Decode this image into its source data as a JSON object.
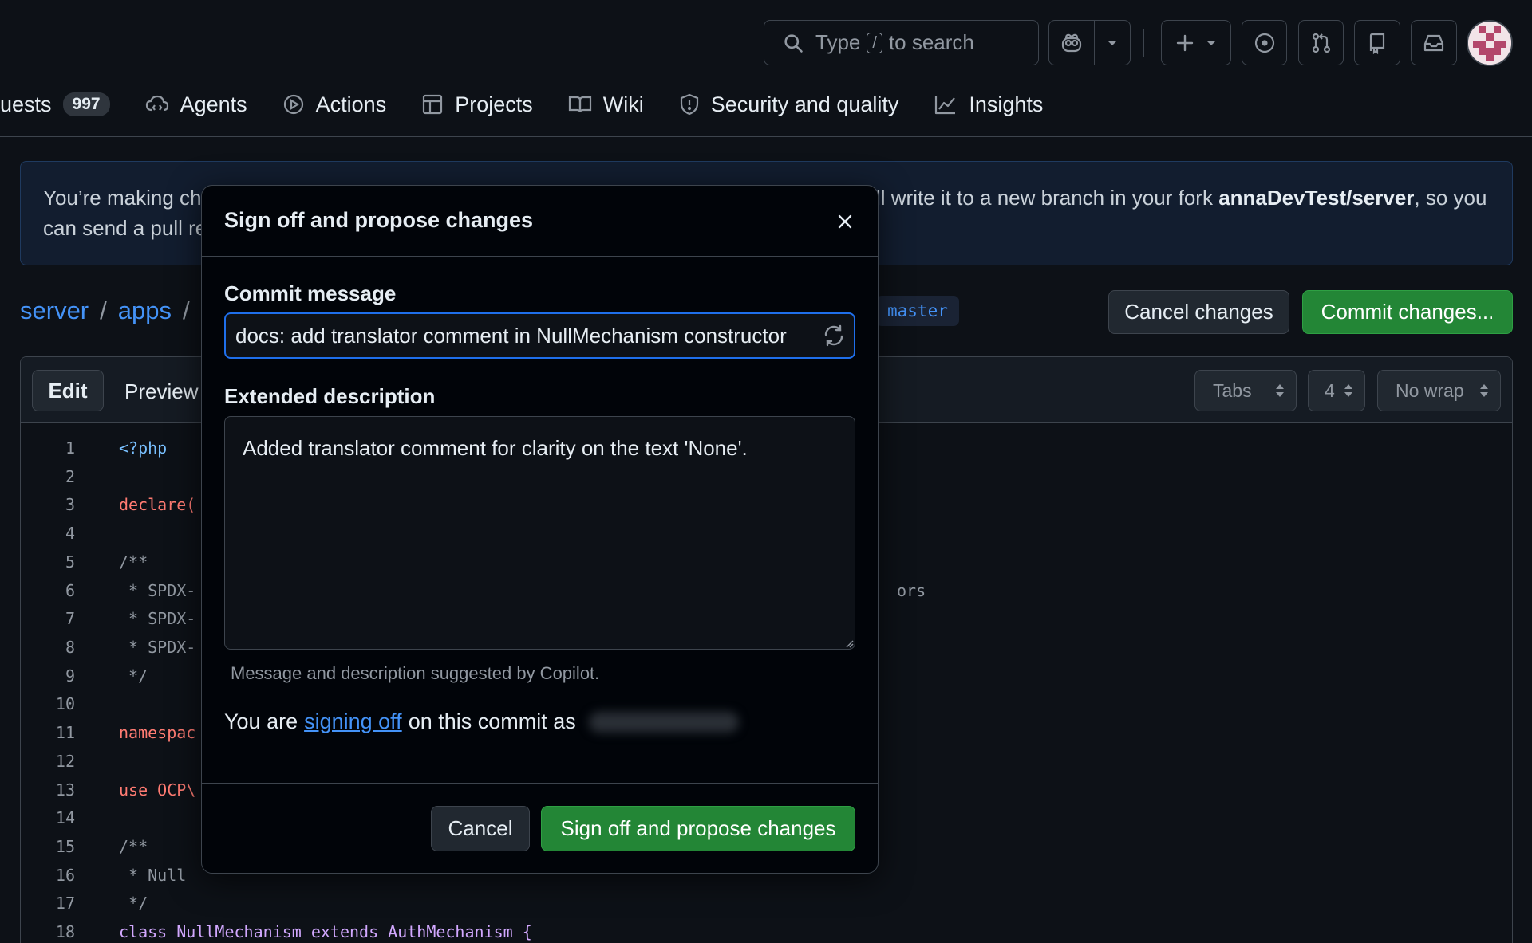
{
  "header": {
    "search_prefix": "Type",
    "search_key": "/",
    "search_suffix": "to search"
  },
  "repo_nav": {
    "items": [
      {
        "label": "uests",
        "counter": "997"
      },
      {
        "label": "Agents"
      },
      {
        "label": "Actions"
      },
      {
        "label": "Projects"
      },
      {
        "label": "Wiki"
      },
      {
        "label": "Security and quality"
      },
      {
        "label": "Insights"
      }
    ]
  },
  "banner": {
    "line1_left": "You’re making ch",
    "line1_right_pre": "ll write it to a new branch in your fork ",
    "fork_name": "annaDevTest/server",
    "line1_right_post": ", so you",
    "line2_left": "can send a pull re"
  },
  "breadcrumb": {
    "repo": "server",
    "folder": "apps",
    "sep": "/"
  },
  "branch": "master",
  "toolbar": {
    "cancel_changes": "Cancel changes",
    "commit_changes": "Commit changes..."
  },
  "editor": {
    "tab_edit": "Edit",
    "tab_preview": "Preview",
    "indent_mode": "Tabs",
    "indent_size": "4",
    "wrap_mode": "No wrap",
    "lines": [
      {
        "n": "1",
        "text": "<?php"
      },
      {
        "n": "2",
        "text": ""
      },
      {
        "n": "3",
        "text": "declare("
      },
      {
        "n": "4",
        "text": ""
      },
      {
        "n": "5",
        "text": "/**"
      },
      {
        "n": "6",
        "text": " * SPDX-"
      },
      {
        "n": "7",
        "text": " * SPDX-"
      },
      {
        "n": "8",
        "text": " * SPDX-"
      },
      {
        "n": "9",
        "text": " */"
      },
      {
        "n": "10",
        "text": ""
      },
      {
        "n": "11",
        "text": "namespac"
      },
      {
        "n": "12",
        "text": ""
      },
      {
        "n": "13",
        "text": "use OCP\\"
      },
      {
        "n": "14",
        "text": ""
      },
      {
        "n": "15",
        "text": "/**"
      },
      {
        "n": "16",
        "text": " * Null "
      },
      {
        "n": "17",
        "text": " */"
      },
      {
        "n": "18",
        "text": "class NullMechanism extends AuthMechanism {"
      }
    ],
    "line6_tail": "ors"
  },
  "modal": {
    "title": "Sign off and propose changes",
    "commit_label": "Commit message",
    "commit_value": "docs: add translator comment in NullMechanism constructor",
    "desc_label": "Extended description",
    "desc_value": "Added translator comment for clarity on the text 'None'.",
    "hint": "Message and description suggested by Copilot.",
    "signoff_pre": "You are",
    "signoff_link": "signing off",
    "signoff_post": "on this commit as",
    "cancel": "Cancel",
    "submit": "Sign off and propose changes"
  },
  "colors": {
    "background": "#0d1117",
    "accent_blue": "#4493f8",
    "primary_green": "#238636",
    "focus_blue": "#1f6feb"
  }
}
